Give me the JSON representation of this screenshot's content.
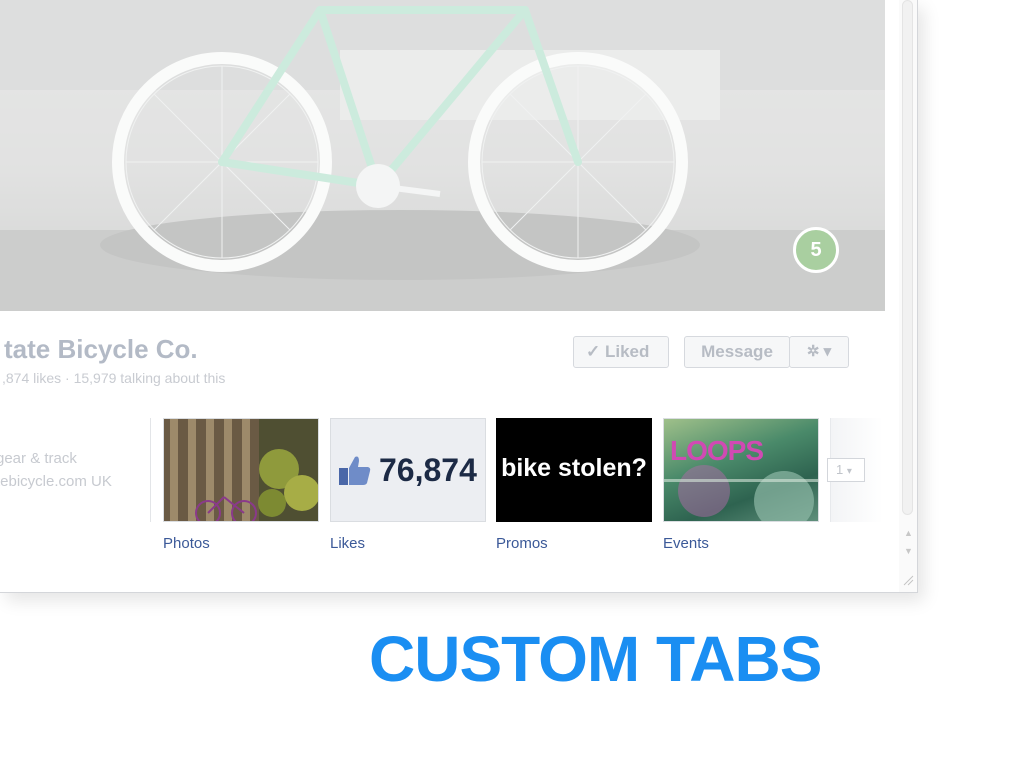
{
  "cover": {
    "photo_count": "5"
  },
  "page": {
    "name": "tate Bicycle Co.",
    "stats": ",874 likes · 15,979 talking about this"
  },
  "actions": {
    "liked_label": "Liked",
    "message_label": "Message"
  },
  "about": {
    "line1": "gear & track",
    "line2": "tebicycle.com UK"
  },
  "tabs": [
    {
      "label": "Photos"
    },
    {
      "label": "Likes",
      "count": "76,874"
    },
    {
      "label": "Promos",
      "text": "bike stolen?"
    },
    {
      "label": "Events",
      "text": "LOOPS"
    }
  ],
  "pager": {
    "value": "1"
  },
  "caption": "CUSTOM TABS",
  "colors": {
    "caption": "#1a8ef2",
    "link": "#3b5998",
    "likes_count": "#1c2a45",
    "photo_badge": "#a9cfa0"
  },
  "icons": [
    "check-icon",
    "gear-icon",
    "chevron-down-icon",
    "thumbs-up-icon",
    "scroll-up-icon",
    "scroll-down-icon",
    "resize-grip-icon"
  ]
}
